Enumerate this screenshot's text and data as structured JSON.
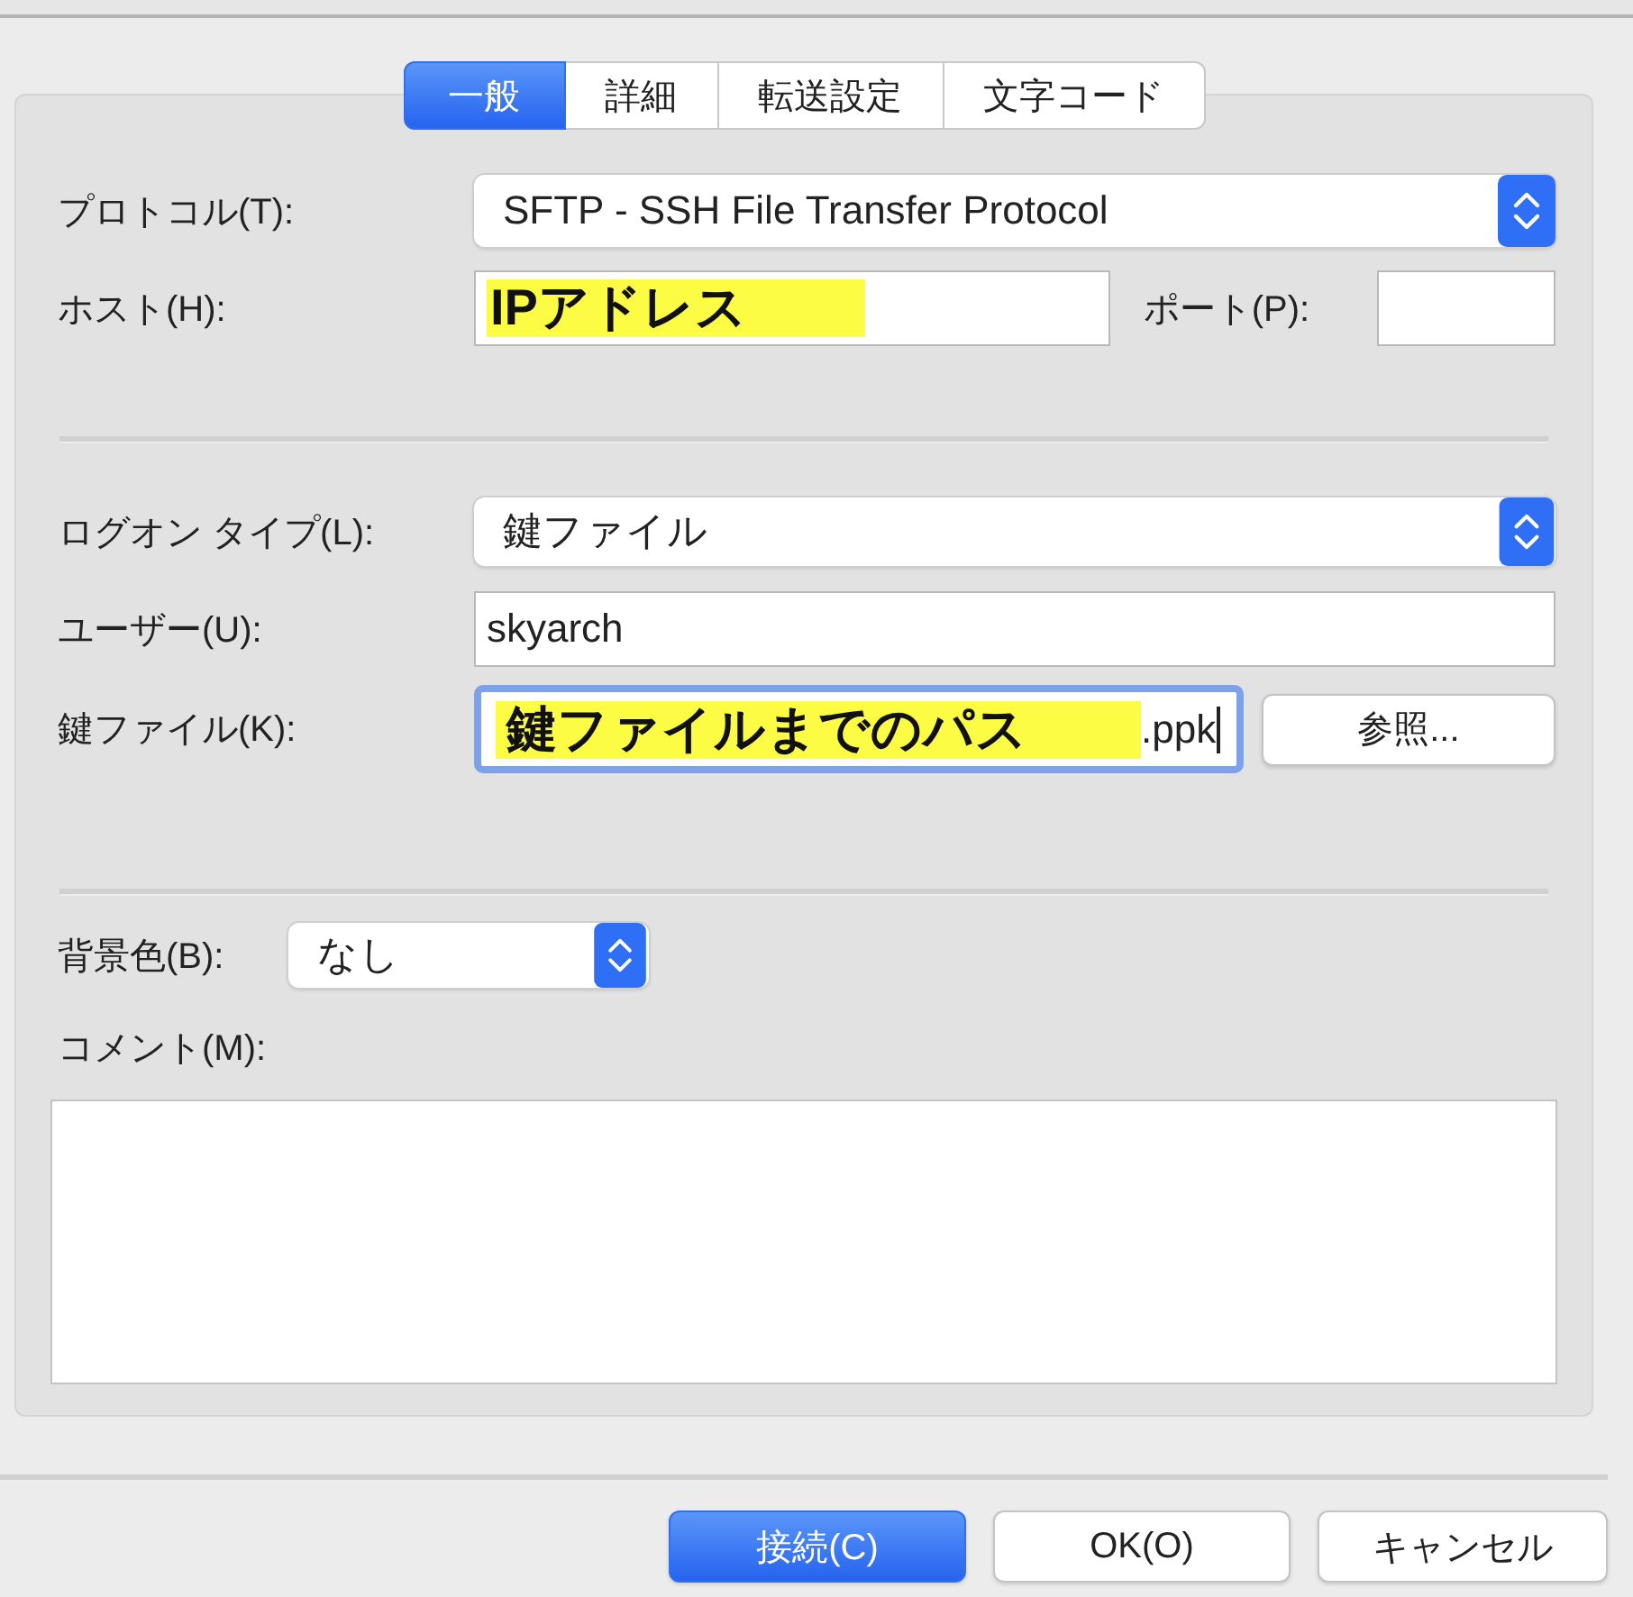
{
  "tabs": [
    {
      "label": "一般",
      "selected": true
    },
    {
      "label": "詳細",
      "selected": false
    },
    {
      "label": "転送設定",
      "selected": false
    },
    {
      "label": "文字コード",
      "selected": false
    }
  ],
  "general": {
    "protocol": {
      "label": "プロトコル(T):",
      "value": "SFTP - SSH File Transfer Protocol"
    },
    "host": {
      "label": "ホスト(H):",
      "highlight": "IPアドレス"
    },
    "port": {
      "label": "ポート(P):"
    },
    "logon_type": {
      "label": "ログオン タイプ(L):",
      "value": "鍵ファイル"
    },
    "user": {
      "label": "ユーザー(U):",
      "value": "skyarch"
    },
    "key_file": {
      "label": "鍵ファイル(K):",
      "highlight": "鍵ファイルまでのパス",
      "value": ".ppk",
      "focused": true
    },
    "browse_button": "参照...",
    "background_color": {
      "label": "背景色(B):",
      "value": "なし"
    },
    "comment": {
      "label": "コメント(M):"
    }
  },
  "buttons": [
    {
      "label": "接続(C)",
      "default": true
    },
    {
      "label": "OK(O)",
      "default": false
    },
    {
      "label": "キャンセル",
      "default": false
    }
  ]
}
